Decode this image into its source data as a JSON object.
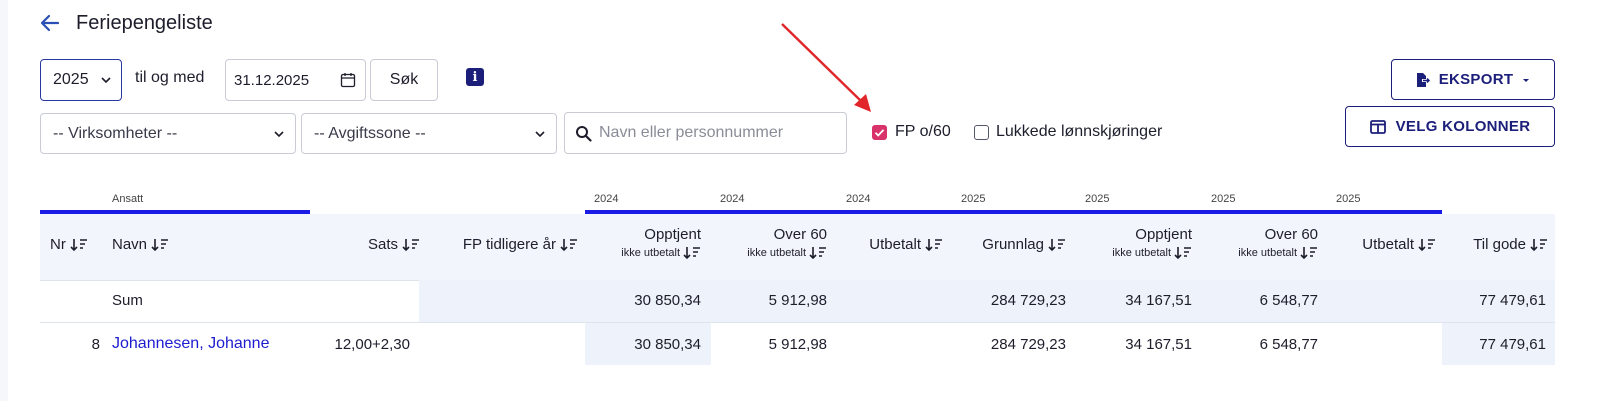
{
  "header": {
    "title": "Feriepengeliste"
  },
  "filters": {
    "year": "2025",
    "til_og_med_label": "til og med",
    "date_value": "31.12.2025",
    "search_button": "Søk",
    "virksomheter": "-- Virksomheter --",
    "avgiftssone": "-- Avgiftssone --",
    "name_placeholder": "Navn eller personnummer",
    "fp_o60_label": "FP o/60",
    "fp_o60_checked": true,
    "lukkede_label": "Lukkede lønnskjøringer",
    "lukkede_checked": false
  },
  "actions": {
    "export_label": "EKSPORT",
    "columns_label": "VELG KOLONNER"
  },
  "table": {
    "groups": {
      "ansatt": "Ansatt",
      "y2024_a": "2024",
      "y2024_b": "2024",
      "y2024_c": "2024",
      "y2025_a": "2025",
      "y2025_b": "2025",
      "y2025_c": "2025",
      "y2025_d": "2025"
    },
    "headers": {
      "nr": "Nr",
      "navn": "Navn",
      "sats": "Sats",
      "fp_tidligere": "FP tidligere år",
      "opptjent_24": "Opptjent",
      "opptjent_24_sub": "ikke utbetalt",
      "over60_24": "Over 60",
      "over60_24_sub": "ikke utbetalt",
      "utbetalt_24": "Utbetalt",
      "grunnlag_25": "Grunnlag",
      "opptjent_25": "Opptjent",
      "opptjent_25_sub": "ikke utbetalt",
      "over60_25": "Over 60",
      "over60_25_sub": "ikke utbetalt",
      "utbetalt_25": "Utbetalt",
      "til_gode": "Til gode"
    },
    "sum_row": {
      "label": "Sum",
      "opptjent_24": "30 850,34",
      "over60_24": "5 912,98",
      "grunnlag_25": "284 729,23",
      "opptjent_25": "34 167,51",
      "over60_25": "6 548,77",
      "til_gode": "77 479,61"
    },
    "rows": [
      {
        "nr": "8",
        "navn": "Johannesen, Johanne",
        "sats": "12,00+2,30",
        "opptjent_24": "30 850,34",
        "over60_24": "5 912,98",
        "grunnlag_25": "284 729,23",
        "opptjent_25": "34 167,51",
        "over60_25": "6 548,77",
        "til_gode": "77 479,61"
      }
    ]
  }
}
